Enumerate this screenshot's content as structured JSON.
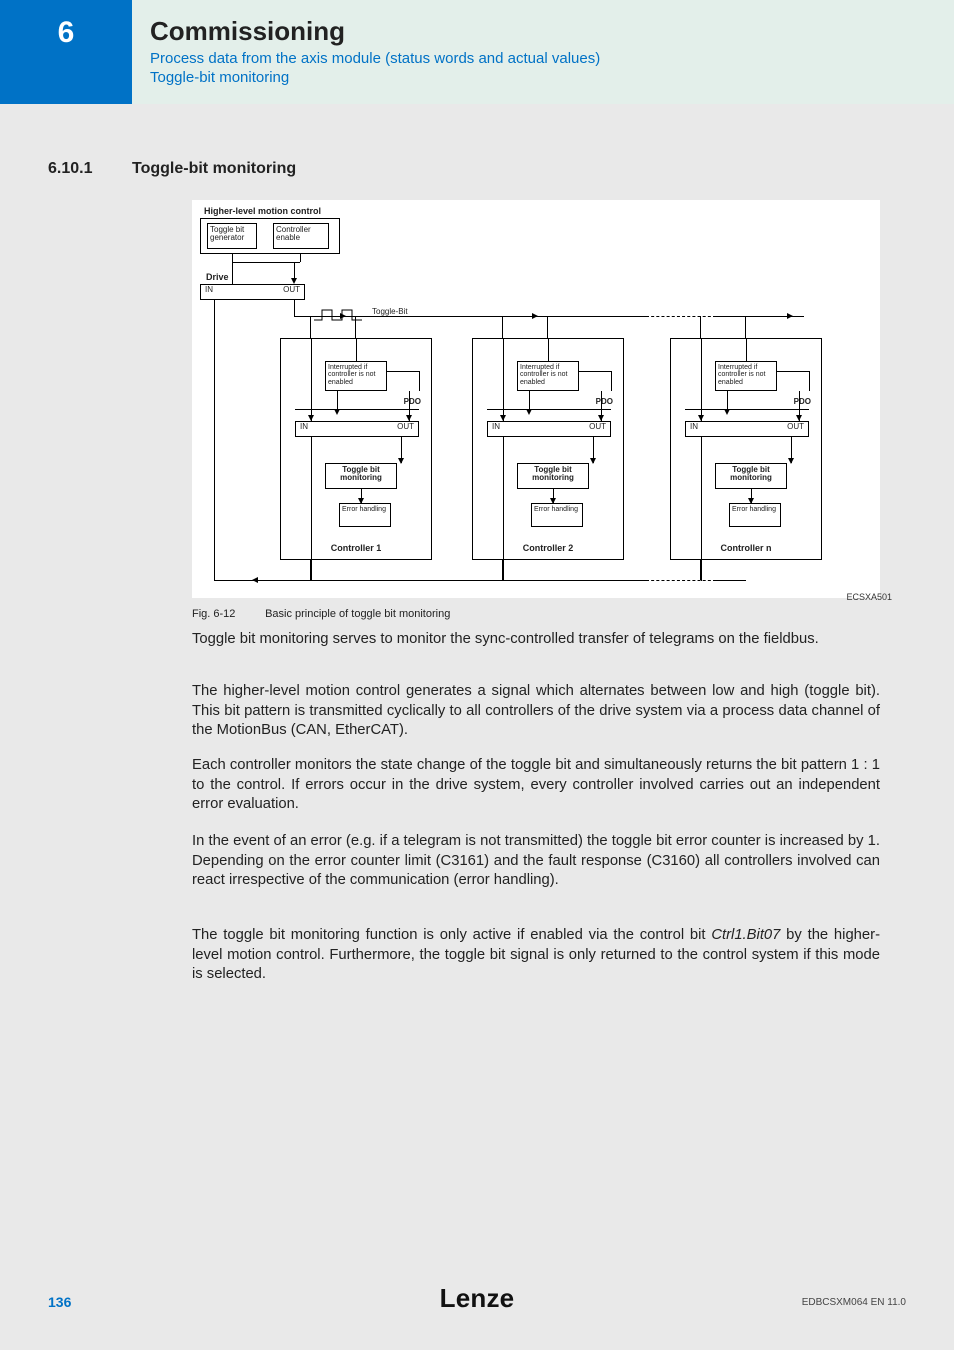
{
  "header": {
    "chapter_number": "6",
    "title": "Commissioning",
    "sub1": "Process data from the axis module (status words and actual values)",
    "sub2": "Toggle-bit monitoring"
  },
  "section": {
    "number": "6.10.1",
    "title": "Toggle-bit monitoring"
  },
  "diagram": {
    "code": "ECSXA501",
    "hl_motion": "Higher-level motion control",
    "toggle_gen": "Toggle bit generator",
    "ctrl_enable": "Controller enable",
    "drive": "Drive",
    "in": "IN",
    "out": "OUT",
    "toggle_bit": "Toggle-Bit",
    "interrupted": "Interrupted if controller is not enabled",
    "pdo": "PDO",
    "toggle_mon": "Toggle bit monitoring",
    "error_handling": "Error handling",
    "controllers": [
      "Controller 1",
      "Controller 2",
      "Controller n"
    ]
  },
  "figure": {
    "label": "Fig. 6-12",
    "caption": "Basic principle of toggle bit monitoring"
  },
  "paragraphs": {
    "p1": "Toggle bit monitoring serves to monitor the sync-controlled transfer of telegrams on the fieldbus.",
    "p2": "The higher-level motion control generates a signal which alternates between low and high (toggle bit). This bit pattern is transmitted cyclically to all controllers of the drive system via a process data channel of the MotionBus (CAN, EtherCAT).",
    "p3": "Each controller monitors the state change of the toggle bit and simultaneously returns the bit pattern 1 : 1 to the control. If errors occur in the drive system, every controller involved carries out an independent error evaluation.",
    "p4": "In the event of an error (e.g. if a telegram is not transmitted) the toggle bit error counter is increased by 1. Depending on the error counter limit (C3161) and the fault response (C3160) all controllers involved can react irrespective of the communication (error handling).",
    "p5a": "The toggle bit monitoring function is only active if enabled via the control bit ",
    "p5_italic": "Ctrl1.Bit07",
    "p5b": " by the higher-level motion control. Furthermore, the toggle bit signal is only returned to the control system if this mode is selected."
  },
  "footer": {
    "page": "136",
    "brand": "Lenze",
    "docid": "EDBCSXM064 EN 11.0"
  }
}
